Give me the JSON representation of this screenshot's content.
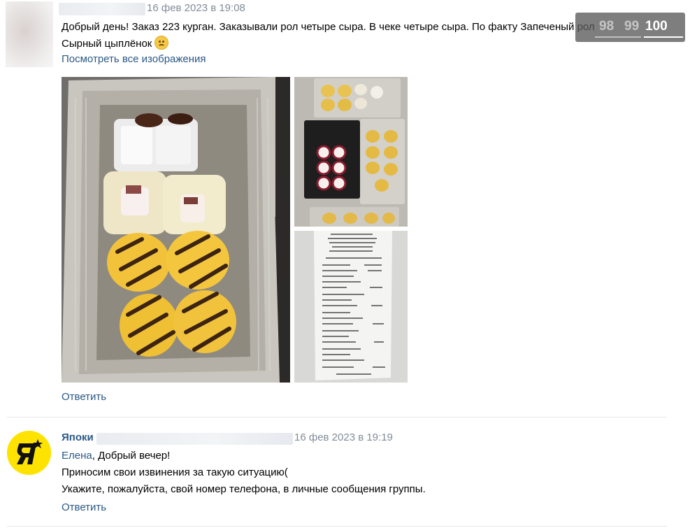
{
  "post": {
    "date": "16 фев 2023 в 19:08",
    "text_line1": "Добрый день! Заказ 223 курган. Заказывали рол четыре сыра. В чеке четыре сыра. По факту Запеченый рол",
    "text_line2": "Сырный цыплёнок",
    "emoji": "sad-face-icon",
    "view_all_images": "Посмотреть все изображения",
    "reply": "Ответить"
  },
  "comment": {
    "author": "Япоки",
    "date": "16 фев 2023 в 19:19",
    "mention": "Елена",
    "line1_rest": ", Добрый вечер!",
    "line2": "Приносим свои извинения за такую ситуацию(",
    "line3": "Укажите, пожалуйста, свой номер телефона, в личные сообщения группы.",
    "reply": "Ответить"
  },
  "pager": {
    "prev2": "98",
    "prev1": "99",
    "current": "100"
  },
  "colors": {
    "link": "#2a5885",
    "meta": "#818c99",
    "brand_yellow": "#ffe300"
  }
}
